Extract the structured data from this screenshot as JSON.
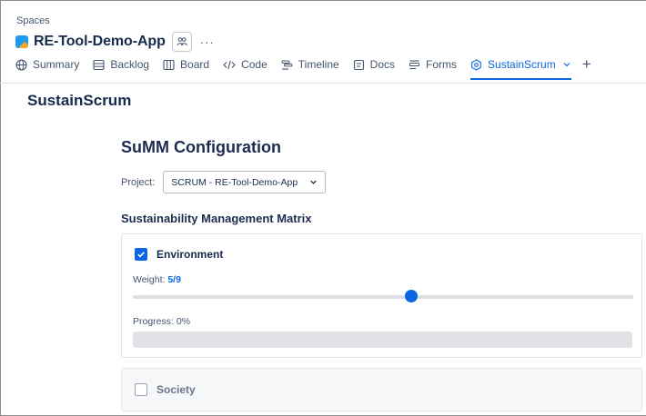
{
  "header": {
    "breadcrumb": "Spaces",
    "app_title": "RE-Tool-Demo-App",
    "more": "···",
    "tabs": [
      {
        "label": "Summary",
        "icon": "globe-icon"
      },
      {
        "label": "Backlog",
        "icon": "backlog-icon"
      },
      {
        "label": "Board",
        "icon": "board-icon"
      },
      {
        "label": "Code",
        "icon": "code-icon"
      },
      {
        "label": "Timeline",
        "icon": "timeline-icon"
      },
      {
        "label": "Docs",
        "icon": "docs-icon"
      },
      {
        "label": "Forms",
        "icon": "forms-icon"
      },
      {
        "label": "SustainScrum",
        "icon": "app-hexagon-icon",
        "active": true
      }
    ],
    "add_tab": "+"
  },
  "page": {
    "title": "SustainScrum"
  },
  "config": {
    "title": "SuMM Configuration",
    "project_label": "Project:",
    "project_value": "SCRUM - RE-Tool-Demo-App",
    "matrix_title": "Sustainability Management Matrix"
  },
  "categories": [
    {
      "name": "Environment",
      "checked": true,
      "weight_label": "Weight:",
      "weight_value": "5/9",
      "weight_fraction": 0.5556,
      "progress_label": "Progress: 0%",
      "progress_fraction": 0
    },
    {
      "name": "Society",
      "checked": false
    }
  ],
  "colors": {
    "accent": "#0c66e4",
    "text": "#172b4d",
    "muted": "#44546f"
  }
}
